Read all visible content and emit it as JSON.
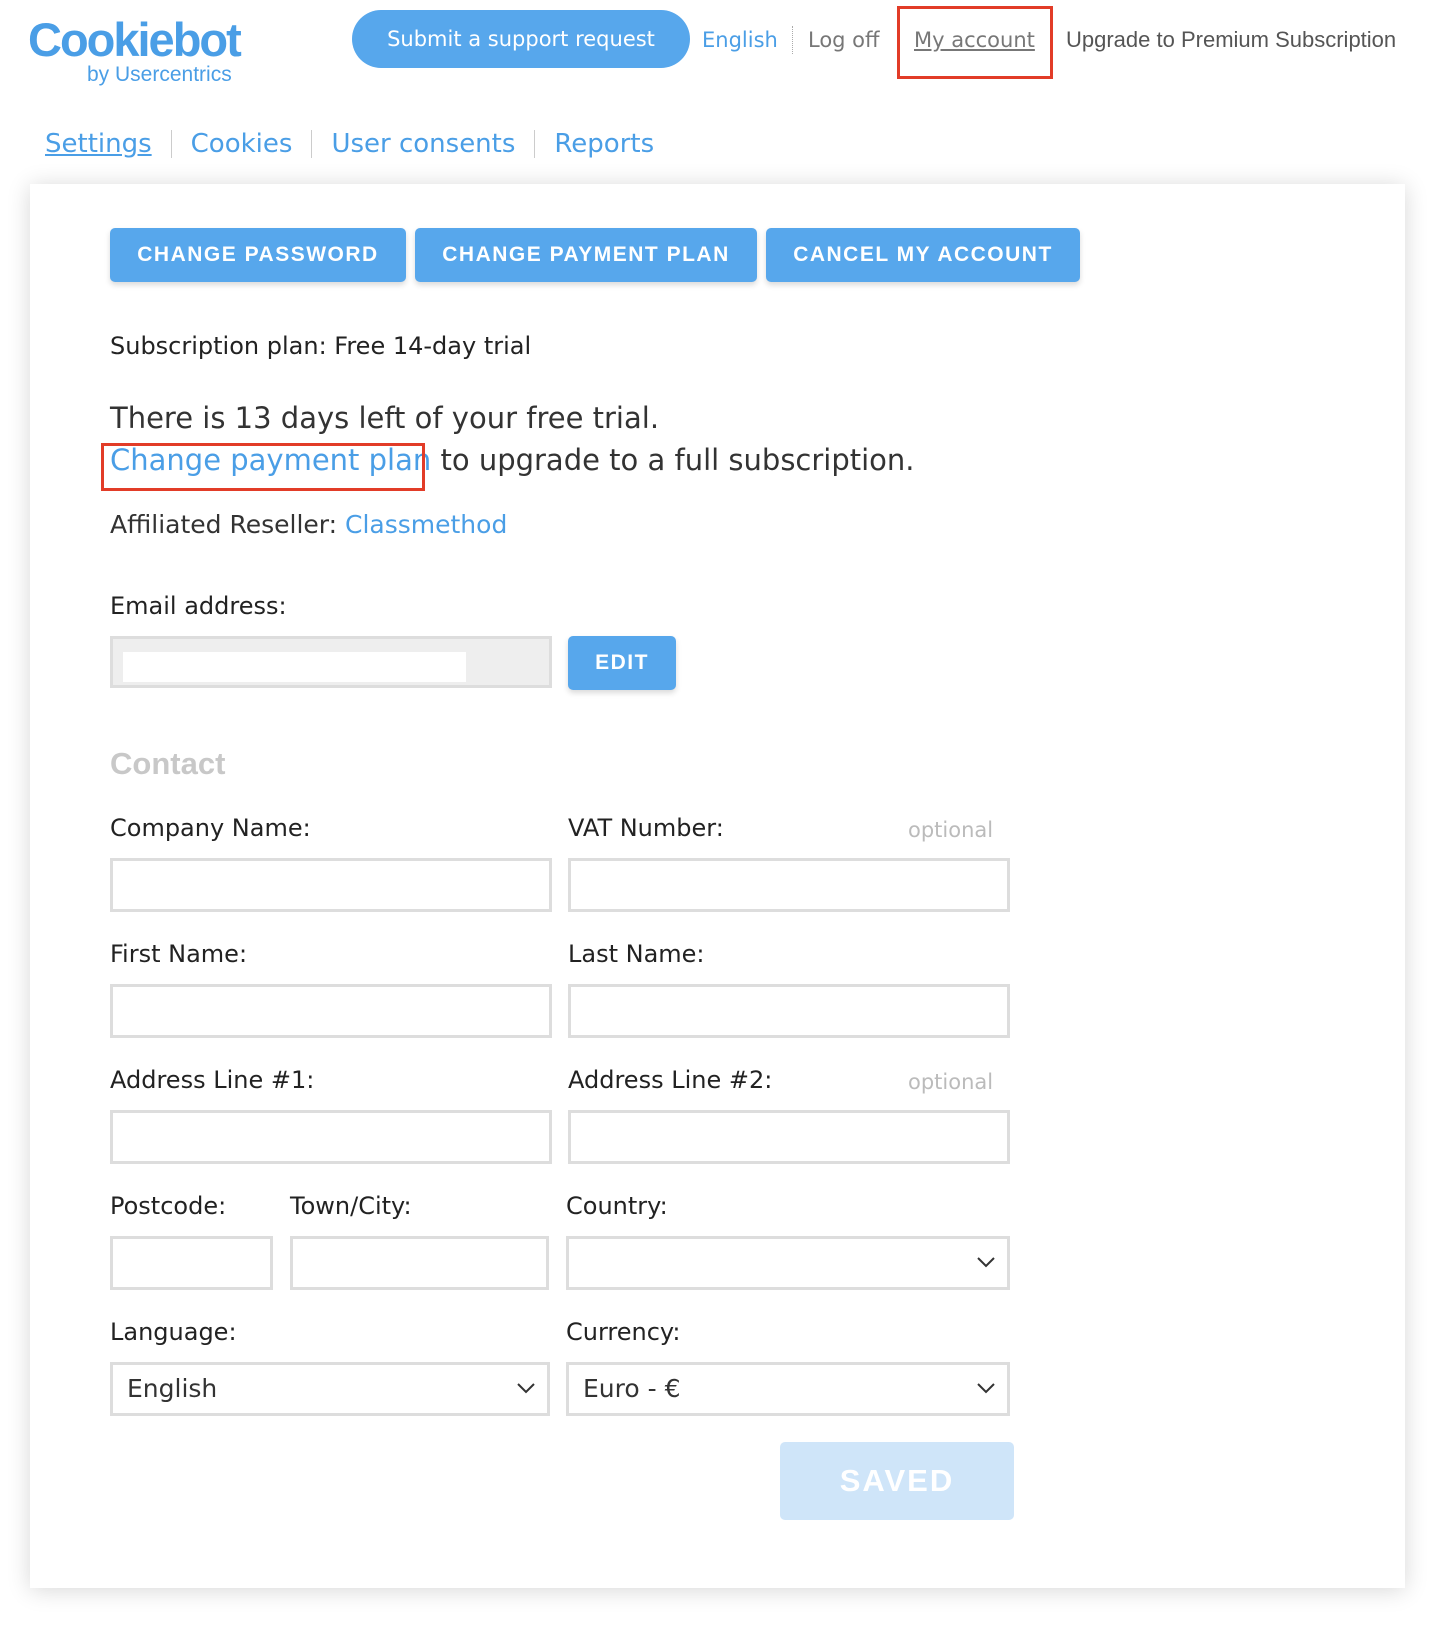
{
  "header": {
    "logo_main": "Cookiebot",
    "logo_sub": "by Usercentrics",
    "support_button": "Submit a support request",
    "language": "English",
    "log_off": "Log off",
    "my_account": "My account",
    "upgrade": "Upgrade to Premium Subscription"
  },
  "nav": {
    "items": [
      {
        "label": "Settings",
        "active": true
      },
      {
        "label": "Cookies"
      },
      {
        "label": "User consents"
      },
      {
        "label": "Reports"
      }
    ]
  },
  "account": {
    "buttons": {
      "change_password": "CHANGE PASSWORD",
      "change_payment_plan": "CHANGE PAYMENT PLAN",
      "cancel_account": "CANCEL MY ACCOUNT"
    },
    "subscription_plan": "Subscription plan: Free 14-day trial",
    "trial_text": "There is 13 days left of your free trial.",
    "change_plan_link": "Change payment plan",
    "upgrade_suffix": " to upgrade to a full subscription.",
    "reseller_label": "Affiliated Reseller: ",
    "reseller_name": "Classmethod",
    "email_label": "Email address:",
    "email_value": "",
    "edit_button": "EDIT"
  },
  "contact": {
    "title": "Contact",
    "company_name": {
      "label": "Company Name:",
      "value": ""
    },
    "vat_number": {
      "label": "VAT Number:",
      "value": "",
      "hint": "optional"
    },
    "first_name": {
      "label": "First Name:",
      "value": ""
    },
    "last_name": {
      "label": "Last Name:",
      "value": ""
    },
    "address1": {
      "label": "Address Line #1:",
      "value": ""
    },
    "address2": {
      "label": "Address Line #2:",
      "value": "",
      "hint": "optional"
    },
    "postcode": {
      "label": "Postcode:",
      "value": ""
    },
    "town": {
      "label": "Town/City:",
      "value": ""
    },
    "country": {
      "label": "Country:",
      "value": ""
    },
    "language": {
      "label": "Language:",
      "value": "English"
    },
    "currency": {
      "label": "Currency:",
      "value": "Euro - €"
    },
    "saved_button": "SAVED"
  },
  "colors": {
    "accent": "#57a7ec",
    "link": "#4a9ee6",
    "highlight": "#e23c28",
    "disabled_button": "#cfe5f9"
  },
  "icons": [
    "chevron-down-icon"
  ]
}
